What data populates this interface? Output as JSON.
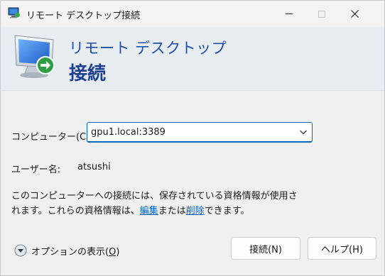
{
  "window": {
    "title": "リモート デスクトップ接続",
    "icons": {
      "app": "remote-desktop-icon",
      "minimize": "minimize-icon",
      "maximize": "maximize-icon",
      "close": "close-icon"
    }
  },
  "banner": {
    "line1": "リモート デスクトップ",
    "line2": "接続",
    "icon": "remote-desktop-monitor-icon"
  },
  "form": {
    "computer_label": "コンピューター(C):",
    "computer_value": "gpu1.local:3389",
    "user_label": "ユーザー名:",
    "user_value": "atsushi"
  },
  "description": {
    "line1": "このコンピューターへの接続には、保存されている資格情報が使用さ",
    "line2_pre": "れます。これらの資格情報は、",
    "edit_link": "編集",
    "mid": "または",
    "delete_link": "削除",
    "line2_post": "できます。"
  },
  "footer": {
    "options_label": "オプションの表示(",
    "options_key": "O",
    "options_close": ")",
    "connect_label": "接続(N)",
    "help_label": "ヘルプ(H)"
  },
  "colors": {
    "accent": "#0067c0",
    "banner_title": "#1f4fa8",
    "link": "#0064c8"
  }
}
